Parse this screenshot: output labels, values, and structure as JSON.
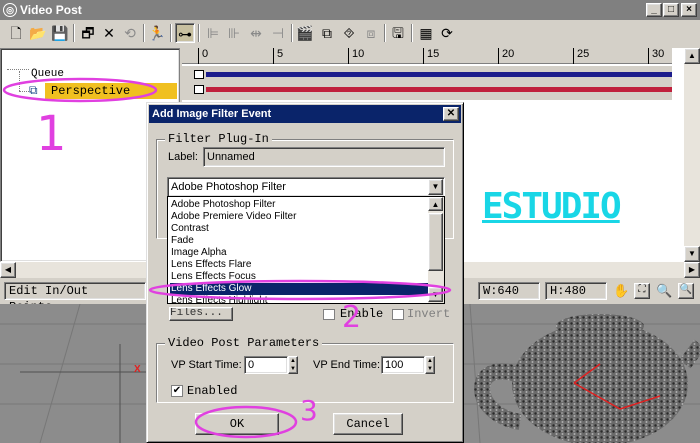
{
  "window": {
    "title": "Video Post",
    "controls": [
      "_",
      "□",
      "×"
    ]
  },
  "toolbar": {
    "icons": [
      "new-icon",
      "open-icon",
      "save-icon",
      "edit-event-icon",
      "delete-event-icon",
      "swap-events-icon",
      "execute-sequence-icon",
      "edit-range-bar-icon",
      "align-left-icon",
      "align-right-icon",
      "make-same-size-icon",
      "abut-selected-icon",
      "add-scene-event-icon",
      "add-image-input-event-icon",
      "add-image-filter-event-icon",
      "add-image-layer-event-icon",
      "add-image-output-event-icon",
      "add-external-event-icon",
      "add-loop-event-icon"
    ]
  },
  "tree": {
    "root": "Queue",
    "item": "Perspective"
  },
  "ruler": {
    "ticks": [
      "0",
      "5",
      "10",
      "15",
      "20",
      "25",
      "30"
    ]
  },
  "status": {
    "prompt": "Edit In/Out Points,",
    "width": "W:640",
    "height": "H:480"
  },
  "logo_text": "ESTUDIO",
  "dialog": {
    "title": "Add Image Filter Event",
    "filter_group": "Filter Plug-In",
    "label_caption": "Label:",
    "label_value": "Unnamed",
    "selected_filter": "Adobe Photoshop Filter",
    "filter_options": [
      "Adobe Photoshop Filter",
      "Adobe Premiere Video Filter",
      "Contrast",
      "Fade",
      "Image Alpha",
      "Lens Effects Flare",
      "Lens Effects Focus",
      "Lens Effects Glow",
      "Lens Effects Highlight"
    ],
    "highlighted_filter": "Lens Effects Glow",
    "setup_partial": "Files...",
    "enable_label": "Enable",
    "invert_label": "Invert",
    "vp_group": "Video Post Parameters",
    "vp_start_label": "VP Start Time:",
    "vp_start_value": "0",
    "vp_end_label": "VP End Time:",
    "vp_end_value": "100",
    "enabled_label": "Enabled",
    "ok_label": "OK",
    "cancel_label": "Cancel"
  },
  "annotations": [
    "1",
    "2",
    "3"
  ],
  "viewport": {
    "axis_label": "X"
  },
  "colors": {
    "title_active": "#0a246a",
    "track_blue": "#1c1c8c",
    "track_red": "#c0203c",
    "annotation": "#e040e0",
    "logo": "#19d6e6"
  }
}
